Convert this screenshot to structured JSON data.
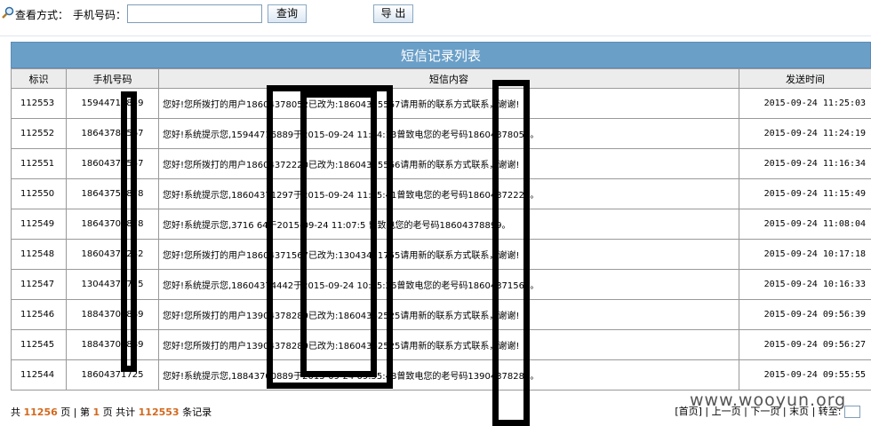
{
  "toolbar": {
    "view_label": "查看方式：",
    "phone_label": "手机号码：",
    "phone_value": "",
    "query_label": "查询",
    "export_label": "导 出"
  },
  "table": {
    "title": "短信记录列表",
    "headers": [
      "标识",
      "手机号码",
      "短信内容",
      "发送时间"
    ],
    "rows": [
      {
        "id": "112553",
        "phone": "15944713859",
        "msg": "您好!您所拨打的用户18604378052已改为:18604375567请用新的联系方式联系，谢谢!",
        "time": "2015-09-24 11:25:03"
      },
      {
        "id": "112552",
        "phone": "18643782567",
        "msg": "您好!系统提示您,15944716889于2015-09-24 11:24:13曾致电您的老号码18604378052。",
        "time": "2015-09-24 11:24:19"
      },
      {
        "id": "112551",
        "phone": "18604373547",
        "msg": "您好!您所拨打的用户18604372220已改为:18604375566请用新的联系方式联系，谢谢!",
        "time": "2015-09-24 11:16:34"
      },
      {
        "id": "112550",
        "phone": "18643757878",
        "msg": "您好!系统提示您,18604371297于2015-09-24 11:15:41曾致电您的老号码18604372220。",
        "time": "2015-09-24 11:15:49"
      },
      {
        "id": "112549",
        "phone": "18643707878",
        "msg": "您好!系统提示您,3716  64于2015-09-24 11:07:5 曾致电您的老号码18604378899。",
        "time": "2015-09-24 11:08:04"
      },
      {
        "id": "112548",
        "phone": "18604371232",
        "msg": "您好!您所拨打的用户18604371567已改为:13043431755请用新的联系方式联系，谢谢!",
        "time": "2015-09-24 10:17:18"
      },
      {
        "id": "112547",
        "phone": "13044371725",
        "msg": "您好!系统提示您,18604374442于2015-09-24 10:15:26曾致电您的老号码18604371567。",
        "time": "2015-09-24 10:16:33"
      },
      {
        "id": "112546",
        "phone": "18843709889",
        "msg": "您好!您所拨打的用户13904378289已改为:18604342525请用新的联系方式联系，谢谢!",
        "time": "2015-09-24 09:56:39"
      },
      {
        "id": "112545",
        "phone": "18843709889",
        "msg": "您好!您所拨打的用户13904378289已改为:18604342525请用新的联系方式联系，谢谢!",
        "time": "2015-09-24 09:56:27"
      },
      {
        "id": "112544",
        "phone": "18604371725",
        "msg": "您好!系统提示您,18843700889于2015-09-24 09:55:48曾致电您的老号码13904378289。",
        "time": "2015-09-24 09:55:55"
      }
    ]
  },
  "footer": {
    "text1": "共",
    "total_pages": "11256",
    "text2": "页 | 第",
    "current_page": "1",
    "text3": "页  共计",
    "total_records": "112553",
    "text4": "条记录"
  },
  "pager": {
    "first": "首页",
    "prev": "上一页",
    "next": "下一页",
    "last": "末页",
    "goto": "转至:",
    "sep": "|"
  },
  "watermark": "www.wooyun.org"
}
